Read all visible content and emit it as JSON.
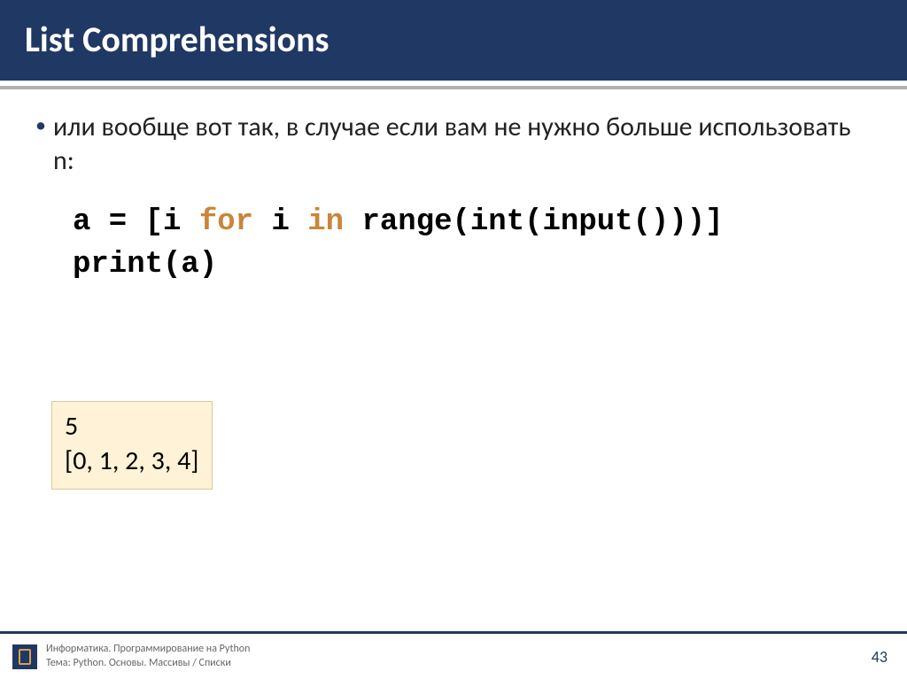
{
  "header": {
    "title": "List Comprehensions"
  },
  "bullet": {
    "text": "или вообще вот так, в случае если вам не нужно больше использовать n:"
  },
  "code": {
    "line1_pre": "a = [i ",
    "line1_kw1": "for",
    "line1_mid": " i ",
    "line1_kw2": "in",
    "line1_post": " range(int(input()))]",
    "line2": "print(a)"
  },
  "output": {
    "line1": "5",
    "line2": "[0, 1, 2, 3, 4]"
  },
  "footer": {
    "line1": "Информатика. Программирование на Python",
    "line2": "Тема: Python. Основы. Массивы / Списки",
    "page": "43"
  }
}
